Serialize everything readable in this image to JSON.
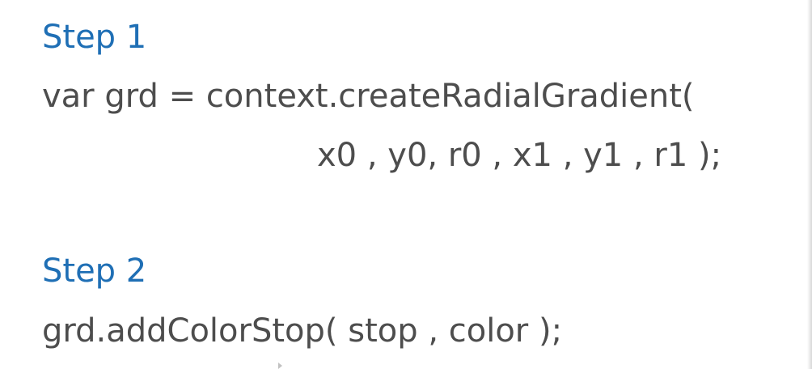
{
  "slide": {
    "step1": {
      "heading": "Step 1",
      "code_line1": "var grd = context.createRadialGradient(",
      "code_line2": "x0 , y0, r0 , x1 , y1 , r1 );"
    },
    "step2": {
      "heading": "Step 2",
      "code_line1": "grd.addColorStop( stop , color );"
    }
  },
  "colors": {
    "heading": "#1f6fb5",
    "code": "#4d4d4d",
    "background": "#ffffff"
  }
}
